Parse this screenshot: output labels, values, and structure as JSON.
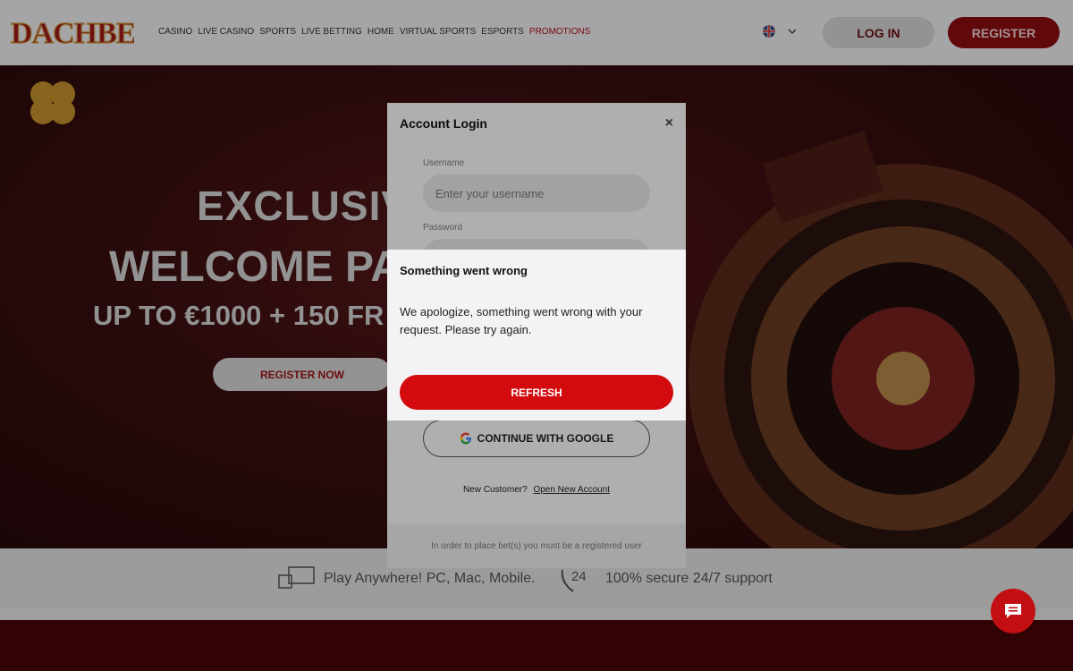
{
  "header": {
    "logo_text": "DACHBET",
    "nav": [
      "CASINO",
      "LIVE CASINO",
      "SPORTS",
      "LIVE BETTING",
      "HOME",
      "VIRTUAL SPORTS",
      "ESPORTS",
      "PROMOTIONS"
    ],
    "active_nav": "PROMOTIONS",
    "login_label": "LOG IN",
    "register_label": "REGISTER"
  },
  "hero": {
    "line1": "EXCLUSIV",
    "line2": "WELCOME PAC",
    "line3": "UP TO €1000 + 150 FR",
    "button": "REGISTER NOW"
  },
  "features": {
    "item1": "Play Anywhere! PC, Mac, Mobile.",
    "item2": "100% secure 24/7 support",
    "support_icon_text": "24"
  },
  "login_modal": {
    "title": "Account Login",
    "close": "×",
    "username_label": "Username",
    "username_placeholder": "Enter your username",
    "password_label": "Password",
    "google_label": "CONTINUE WITH GOOGLE",
    "new_customer": "New Customer?",
    "open_account": "Open New Account",
    "footer_text": "In order to place bet(s) you must be a registered user"
  },
  "error_modal": {
    "title": "Something went wrong",
    "message": "We apologize, something went wrong with your request. Please try again.",
    "button": "REFRESH"
  }
}
